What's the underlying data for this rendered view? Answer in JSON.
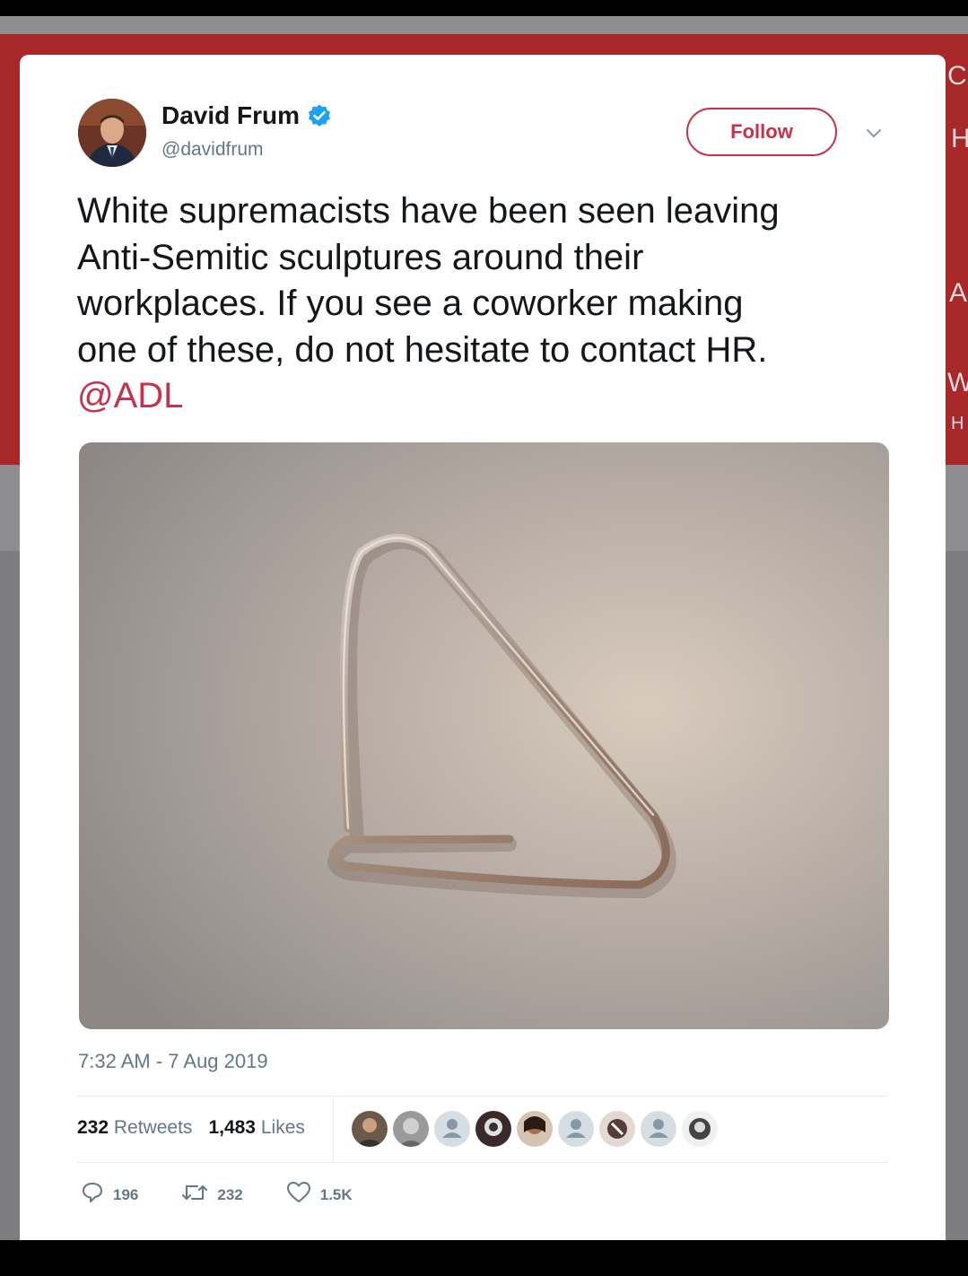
{
  "tweet": {
    "author_name": "David Frum",
    "author_handle": "@davidfrum",
    "follow_label": "Follow",
    "text_lines": [
      "White supremacists have been seen leaving",
      "Anti-Semitic sculptures around their",
      "workplaces.  If you see a coworker making",
      "one of these, do not hesitate to contact HR."
    ],
    "mention": "@ADL",
    "timestamp": "7:32 AM - 7 Aug 2019",
    "retweets_count": "232",
    "retweets_label": "Retweets",
    "likes_count": "1,483",
    "likes_label": "Likes",
    "reply_count": "196",
    "retweet_count_short": "232",
    "like_count_short": "1.5K"
  },
  "background_edge_letters": [
    "C",
    "H",
    "A",
    "W",
    "H"
  ],
  "colors": {
    "accent": "#c9314a",
    "verified": "#1da1f2",
    "background_red": "#a8282a",
    "text_primary": "#14171a",
    "text_secondary": "#657786"
  },
  "icons": [
    "verified-badge-icon",
    "chevron-down-icon",
    "reply-icon",
    "retweet-icon",
    "like-icon"
  ]
}
